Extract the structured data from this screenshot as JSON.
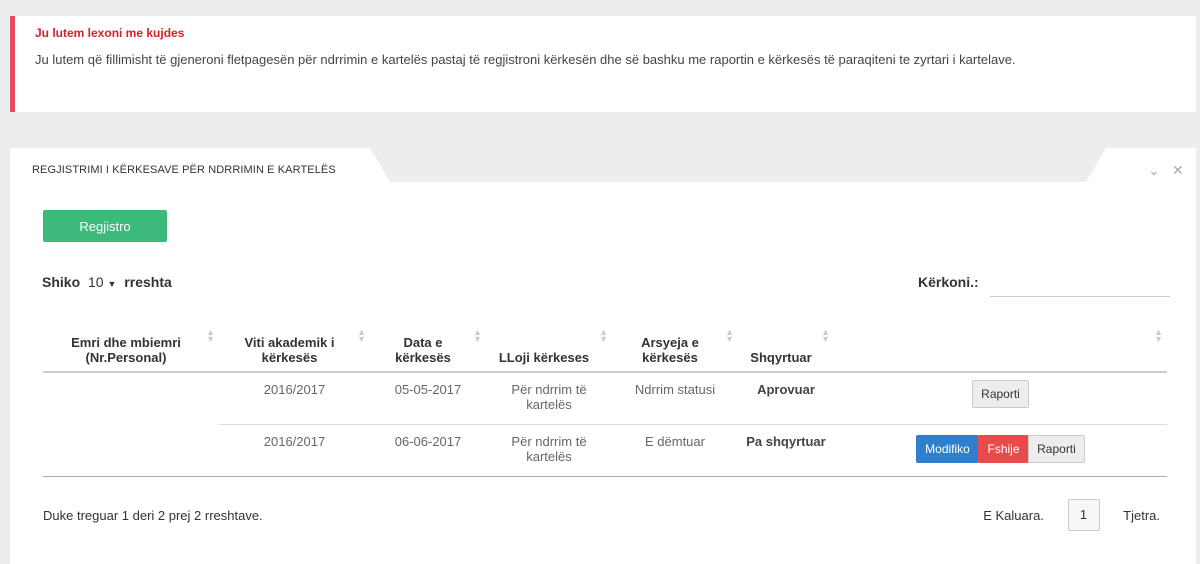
{
  "alert": {
    "title": "Ju lutem lexoni me kujdes",
    "text": "Ju lutem që fillimisht të gjeneroni fletpagesën për ndrrimin e kartelës pastaj të regjistroni kërkesën dhe së bashku me raportin e kërkesës të paraqiteni te zyrtari i kartelave.",
    "accent_color": "#e84a5f"
  },
  "panel": {
    "title": "REGJISTRIMI I KËRKESAVE PËR NDRRIMIN E KARTELËS",
    "collapse_icon": "chevron-down-icon",
    "close_icon": "close-icon"
  },
  "toolbar": {
    "register_label": "Regjistro",
    "register_color": "#3cb97b"
  },
  "length": {
    "prefix": "Shiko",
    "value": "10",
    "suffix": "rreshta"
  },
  "search": {
    "label": "Kërkoni.:",
    "value": ""
  },
  "table": {
    "columns": [
      "Emri dhe mbiemri (Nr.Personal)",
      "Viti akademik i kërkesës",
      "Data e kërkesës",
      "LLoji kërkeses",
      "Arsyeja e kërkesës",
      "Shqyrtuar",
      ""
    ],
    "rows": [
      {
        "name": "",
        "year": "2016/2017",
        "date": "05-05-2017",
        "type": "Për ndrrim të kartelës",
        "reason": "Ndrrim statusi",
        "status": "Aprovuar",
        "actions": {
          "report": "Raporti"
        }
      },
      {
        "name": "",
        "year": "2016/2017",
        "date": "06-06-2017",
        "type": "Për ndrrim të kartelës",
        "reason": "E dëmtuar",
        "status": "Pa shqyrtuar",
        "actions": {
          "edit": "Modifiko",
          "delete": "Fshije",
          "report": "Raporti"
        }
      }
    ]
  },
  "footer": {
    "info": "Duke treguar 1 deri 2 prej 2 rreshtave.",
    "prev": "E Kaluara.",
    "page": "1",
    "next": "Tjetra."
  },
  "colors": {
    "edit": "#2f7fcf",
    "delete": "#e94b4b"
  }
}
